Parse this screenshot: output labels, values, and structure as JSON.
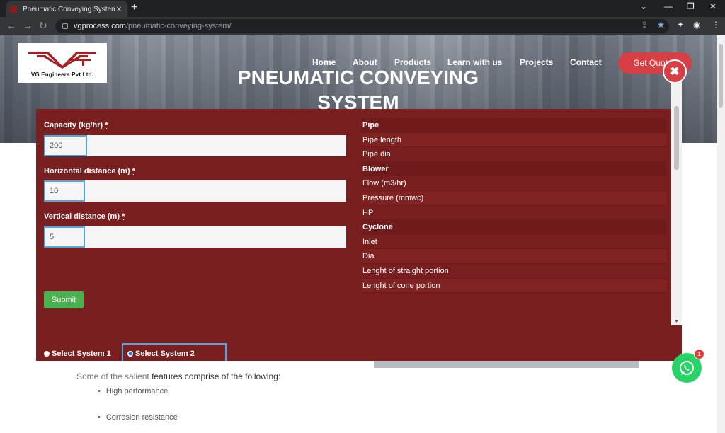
{
  "browser": {
    "tab_title": "Pneumatic Conveying System, Ec",
    "url_host": "vgprocess.com",
    "url_path": "/pneumatic-conveying-system/"
  },
  "site": {
    "logo_text": "VG Engineers Pvt Ltd.",
    "nav": [
      "Home",
      "About",
      "Products",
      "Learn with us",
      "Projects",
      "Contact"
    ],
    "cta": "Get Quotes",
    "hero_title_line1": "PNEUMATIC CONVEYING",
    "hero_title_line2": "SYSTEM"
  },
  "form": {
    "capacity_label": "Capacity (kg/hr)",
    "capacity_value": "200",
    "horizontal_label": "Horizontal distance (m)",
    "horizontal_value": "10",
    "vertical_label": "Vertical distance (m)",
    "vertical_value": "5",
    "required_mark": "*",
    "submit_label": "Submit"
  },
  "results": [
    {
      "label": "Pipe",
      "header": true
    },
    {
      "label": "Pipe length",
      "header": false
    },
    {
      "label": "Pipe dia",
      "header": false
    },
    {
      "label": "Blower",
      "header": true
    },
    {
      "label": "Flow (m3/hr)",
      "header": false
    },
    {
      "label": "Pressure (mmwc)",
      "header": false
    },
    {
      "label": "HP",
      "header": false
    },
    {
      "label": "Cyclone",
      "header": true
    },
    {
      "label": "Inlet",
      "header": false
    },
    {
      "label": "Dia",
      "header": false
    },
    {
      "label": "Lenght of straight portion",
      "header": false
    },
    {
      "label": "Lenght of cone portion",
      "header": false
    }
  ],
  "systems": {
    "option1": "Select System 1",
    "option2": "Select System 2",
    "selected": "Select System 2"
  },
  "content": {
    "intro_muted": "Some of the salient",
    "intro_strong": "features comprise of the following:",
    "bullets": [
      "High performance",
      "Corrosion resistance"
    ]
  },
  "chat": {
    "badge_count": "1"
  },
  "colors": {
    "modal_bg": "#7a1f1f",
    "accent_red": "#d64045",
    "submit_green": "#4caf50",
    "focus_blue": "#4aa8e8",
    "whatsapp_green": "#25d366"
  }
}
